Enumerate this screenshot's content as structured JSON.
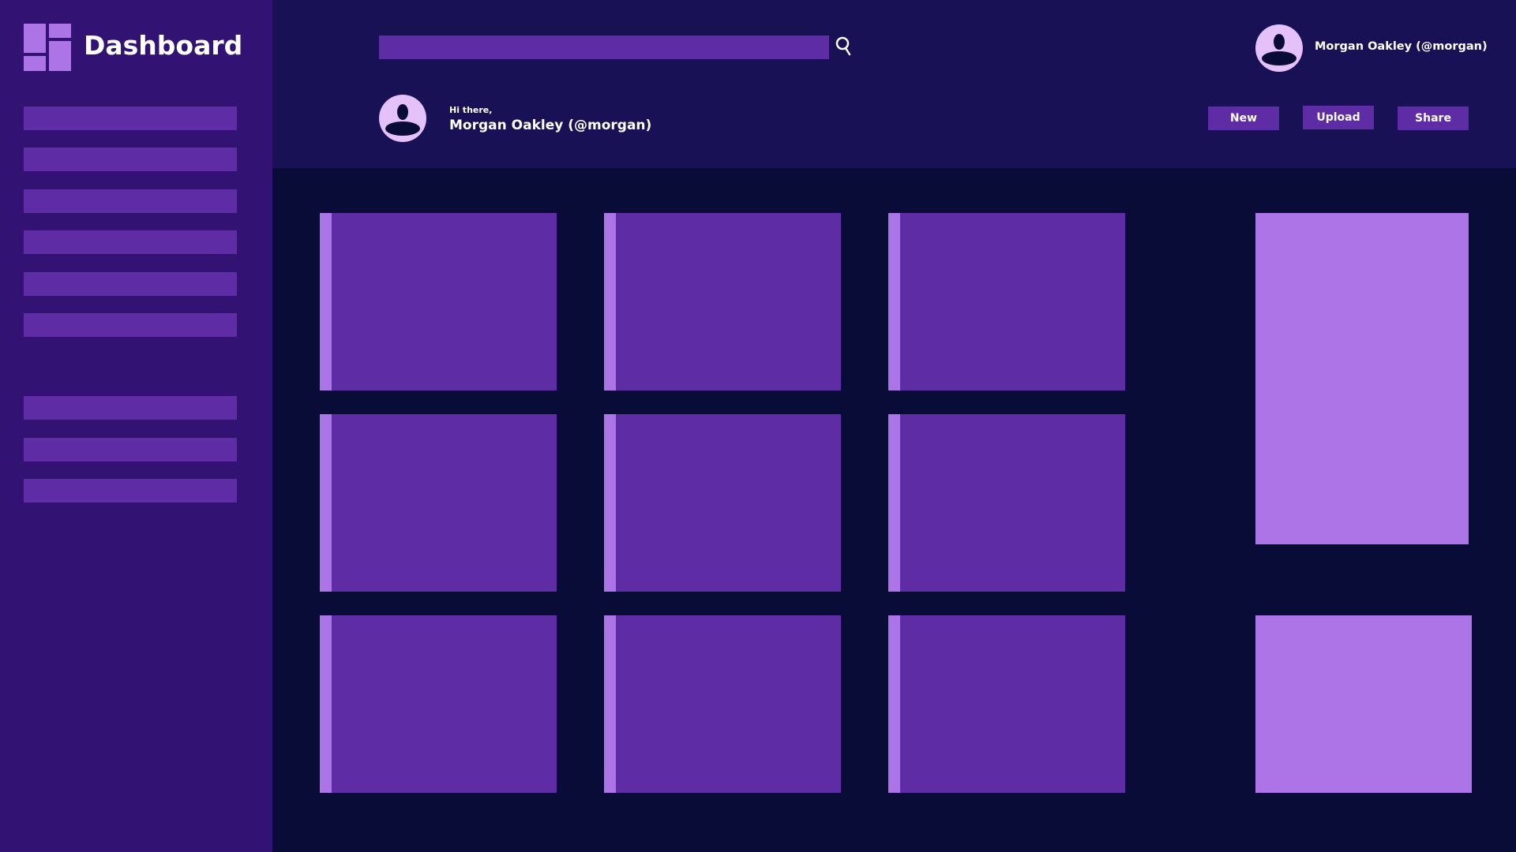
{
  "app": {
    "title": "Dashboard"
  },
  "sidebar": {
    "nav_items": [
      "",
      "",
      "",
      "",
      "",
      "",
      "",
      "",
      ""
    ]
  },
  "search": {
    "value": "",
    "placeholder": ""
  },
  "user": {
    "display_name": "Morgan Oakley (@morgan)",
    "greeting": "Hi there,"
  },
  "actions": {
    "new": "New",
    "upload": "Upload",
    "share": "Share"
  },
  "colors": {
    "sidebar_bg": "#321373",
    "topbar_bg": "#181155",
    "main_bg": "#0a0c38",
    "accent": "#5e2ca5",
    "accent_light": "#ad74e8",
    "avatar_bg": "#e4c1f9"
  },
  "icons": {
    "logo": "dashboard-logo-icon",
    "search": "search-icon",
    "avatar": "user-avatar-icon"
  }
}
